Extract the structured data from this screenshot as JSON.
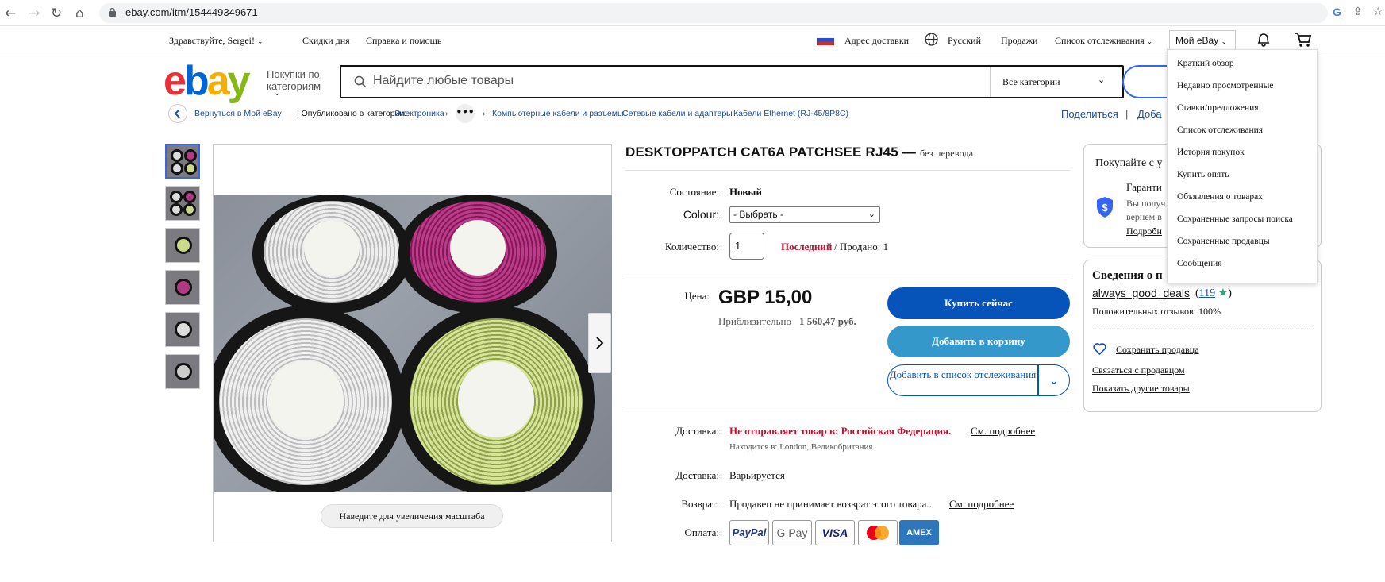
{
  "browser": {
    "url": "ebay.com/itm/154449349671"
  },
  "topnav": {
    "greeting": "Здравствуйте, Sergei!",
    "deals": "Скидки дня",
    "help": "Справка и помощь",
    "address": "Адрес доставки",
    "language": "Русский",
    "selling": "Продажи",
    "watchlist": "Список отслеживания",
    "my_ebay": "Мой eBay"
  },
  "header": {
    "shop_by_category": "Покупки по категориям",
    "search_placeholder": "Найдите любые товары",
    "all_categories": "Все категории"
  },
  "breadcrumb": {
    "back": "Вернуться в Мой eBay",
    "published_in": "| Опубликовано в категории:",
    "items": [
      "Электроника",
      "Компьютерные кабели и разъемы",
      "Сетевые кабели и адаптеры",
      "Кабели Ethernet (RJ-45/8P8C)"
    ],
    "share": "Поделиться",
    "add_partial": "Доба"
  },
  "gallery": {
    "zoom_hint": "Наведите для увеличения масштаба"
  },
  "product": {
    "title": "DESKTOPPATCH CAT6A PATCHSEE RJ45 —",
    "untranslated": "без перевода",
    "condition_label": "Состояние:",
    "condition_value": "Новый",
    "colour_label": "Colour:",
    "colour_value": "- Выбрать -",
    "quantity_label": "Количество:",
    "quantity_value": "1",
    "last_one": "Последний",
    "sold": "/ Продано: 1",
    "price_label": "Цена:",
    "price": "GBP 15,00",
    "approx": "Приблизительно",
    "approx_value": "1 560,47 руб.",
    "buy_now": "Купить сейчас",
    "add_to_cart": "Добавить в корзину",
    "add_to_watchlist": "Добавить в список отслеживания",
    "delivery_label": "Доставка:",
    "no_ship": "Не отправляет товар в: Российская Федерация.",
    "see_details": "См. подробнее",
    "located": "Находится в: London, Великобритания",
    "delivery_label_2": "Доставка:",
    "delivery_value_2": "Варьируется",
    "returns_label": "Возврат:",
    "returns_value": "Продавец не принимает возврат этого товара..",
    "payment_label": "Оплата:",
    "payments": [
      "PayPal",
      "G Pay",
      "VISA",
      "Mastercard",
      "AMEX"
    ]
  },
  "buyer_box": {
    "title_partial": "Покупайте с у",
    "guarantee_partial": "Гаранти",
    "line1_partial": "Вы получ",
    "line2_partial": "вернем в",
    "more_partial": "Подробн"
  },
  "seller_box": {
    "title_partial": "Сведения о п",
    "seller_name": "always_good_deals",
    "feedback_count": "119",
    "positive": "Положительных отзывов: 100%",
    "save_seller": "Сохранить продавца",
    "contact_seller": "Связаться с продавцом",
    "other_items": "Показать другие товары"
  },
  "myebay_menu": {
    "items": [
      "Краткий обзор",
      "Недавно просмотренные",
      "Ставки/предложения",
      "Список отслеживания",
      "История покупок",
      "Купить опять",
      "Объявления о товарах",
      "Сохраненные запросы поиска",
      "Сохраненные продавцы",
      "Сообщения"
    ]
  },
  "colors": {
    "ebay_red": "#e53238",
    "ebay_blue": "#0064d2",
    "ebay_yellow": "#f5af02",
    "ebay_green": "#86b817",
    "buy_now_bg": "#0654ba",
    "cart_bg": "#3498ca",
    "alert_red": "#c4102d"
  }
}
